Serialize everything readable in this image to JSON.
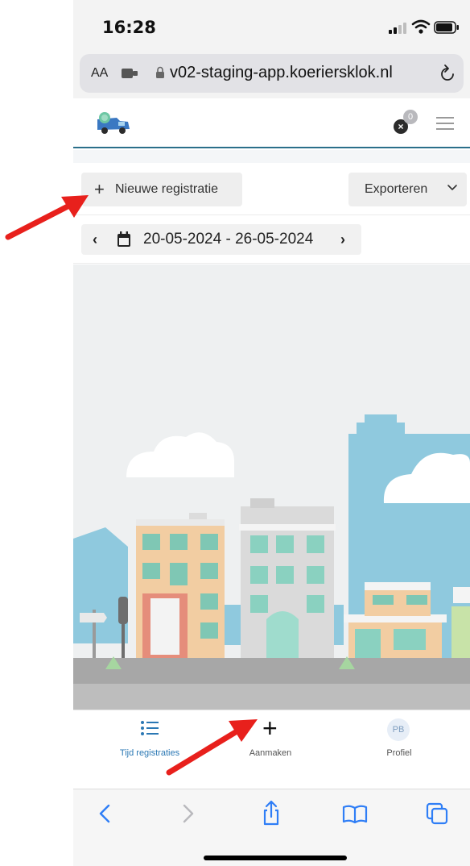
{
  "status": {
    "time": "16:28"
  },
  "address_bar": {
    "text_size_label": "AA",
    "url": "v02-staging-app.koeriersklok.nl"
  },
  "header": {
    "notification_count": "0"
  },
  "toolbar": {
    "new_registration_label": "Nieuwe registratie",
    "export_label": "Exporteren"
  },
  "date_range": {
    "value": "20-05-2024 - 26-05-2024"
  },
  "tabs": [
    {
      "label": "Tijd registraties",
      "icon": "list-icon",
      "active": true
    },
    {
      "label": "Aanmaken",
      "icon": "plus-icon",
      "active": false
    },
    {
      "label": "Profiel",
      "icon": "avatar",
      "initials": "PB",
      "active": false
    }
  ],
  "colors": {
    "accent": "#2b78b4",
    "header_border": "#2a6f8a",
    "annotation_arrow": "#e8201c"
  }
}
